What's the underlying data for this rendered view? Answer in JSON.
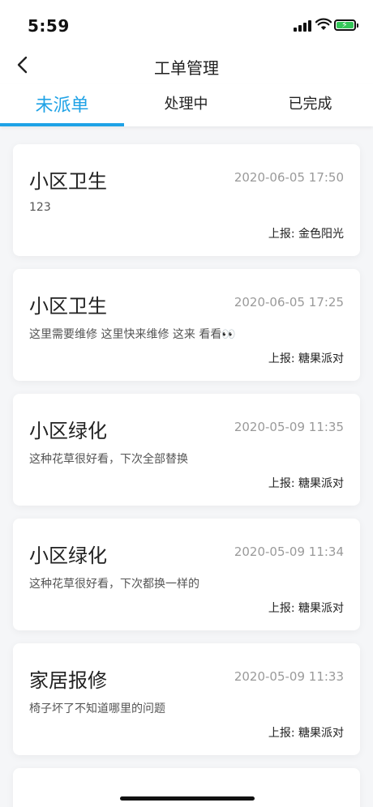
{
  "status": {
    "time": "5:59"
  },
  "nav": {
    "title": "工单管理"
  },
  "tabs": [
    {
      "label": "未派单",
      "active": true
    },
    {
      "label": "处理中",
      "active": false
    },
    {
      "label": "已完成",
      "active": false
    }
  ],
  "orders": [
    {
      "title": "小区卫生",
      "time": "2020-06-05 17:50",
      "desc": "123",
      "reporter": "上报: 金色阳光"
    },
    {
      "title": "小区卫生",
      "time": "2020-06-05 17:25",
      "desc": "这里需要维修 这里快来维修 这来 看看👀",
      "reporter": "上报: 糖果派对"
    },
    {
      "title": "小区绿化",
      "time": "2020-05-09 11:35",
      "desc": "这种花草很好看，下次全部替换",
      "reporter": "上报: 糖果派对"
    },
    {
      "title": "小区绿化",
      "time": "2020-05-09 11:34",
      "desc": "这种花草很好看，下次都换一样的",
      "reporter": "上报: 糖果派对"
    },
    {
      "title": "家居报修",
      "time": "2020-05-09 11:33",
      "desc": "椅子坏了不知道哪里的问题",
      "reporter": "上报: 糖果派对"
    }
  ],
  "colors": {
    "accent": "#1ea2e6",
    "battery": "#33c758"
  }
}
